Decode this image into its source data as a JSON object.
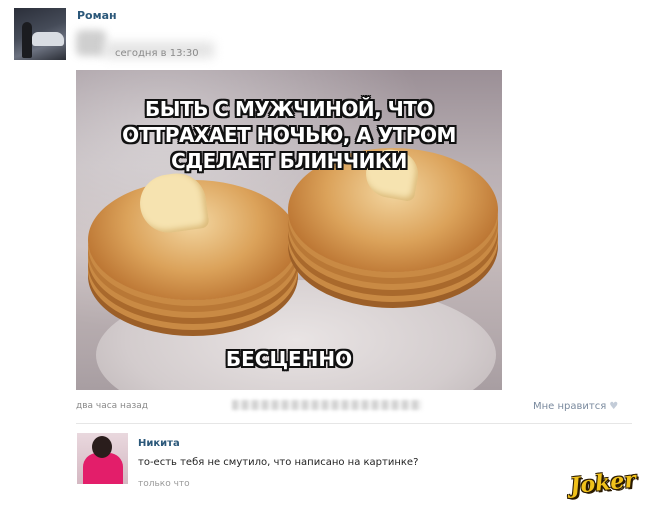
{
  "post": {
    "author": "Роман",
    "time": "сегодня в 13:30",
    "image": {
      "caption_top": [
        "БЫТЬ С МУЖЧИНОЙ, ЧТО",
        "ОТТРАХАЕТ НОЧЬЮ, А УТРОМ",
        "СДЕЛАЕТ БЛИНЧИКИ"
      ],
      "caption_bottom": "БЕСЦЕННО"
    },
    "meta_time": "два часа назад",
    "like_label": "Мне нравится",
    "like_icon": "heart-icon"
  },
  "comment": {
    "author": "Никита",
    "text": "то-есть тебя не смутило, что написано на картинке?",
    "time": "только что"
  },
  "watermark": "Joker",
  "colors": {
    "link": "#2b587a",
    "meta": "#8a8a8a",
    "watermark": "#f1c21b"
  }
}
